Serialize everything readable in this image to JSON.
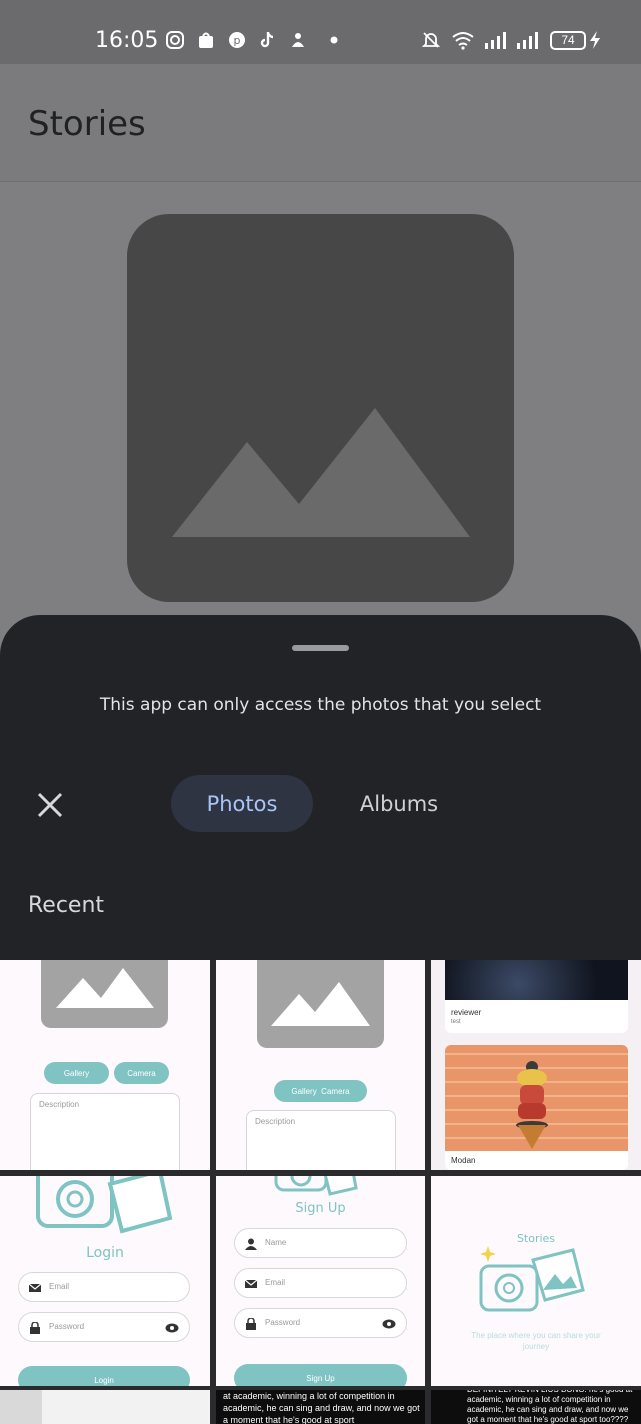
{
  "status_bar": {
    "time": "16:05",
    "battery": "74",
    "icons": [
      "instagram-icon",
      "shopee-icon",
      "pinterest-icon",
      "tiktok-icon",
      "app-icon",
      "dot-icon",
      "mute-icon",
      "wifi-icon",
      "signal-icon",
      "signal-icon",
      "battery-icon",
      "charging-icon"
    ]
  },
  "app_bar": {
    "title": "Stories"
  },
  "sheet": {
    "notice": "This app can only access the photos that you select",
    "tabs": [
      {
        "label": "Photos",
        "selected": true
      },
      {
        "label": "Albums",
        "selected": false
      }
    ],
    "section_title": "Recent"
  },
  "thumbnails": {
    "t1": {
      "gallery": "Gallery",
      "camera": "Camera",
      "description": "Description"
    },
    "t2": {
      "gallery": "Gallery",
      "camera": "Camera",
      "description": "Description"
    },
    "t3": {
      "reviewer": "reviewer",
      "reviewer_sub": "test",
      "caption": "Modan"
    },
    "t4": {
      "title": "Login",
      "email": "Email",
      "password": "Password",
      "button": "Login"
    },
    "t5": {
      "title": "Sign Up",
      "name": "Name",
      "email": "Email",
      "password": "Password",
      "button": "Sign Up"
    },
    "t6": {
      "title": "Stories",
      "tagline": "The place where you can share your journey"
    },
    "t8": {
      "text": "at academic, winning a lot of competition in academic, he can sing and draw, and now we got a moment that he's good at sport"
    },
    "t9": {
      "text": "DEFINITELY KEVIN LIUS BONG. he's good at academic, winning a lot of competition in academic, he can sing and draw, and now we got a moment that he's good at sport too????"
    }
  },
  "colors": {
    "accent": "#a9c4f7",
    "sheet": "#222327",
    "teal": "#7fc3c3"
  }
}
